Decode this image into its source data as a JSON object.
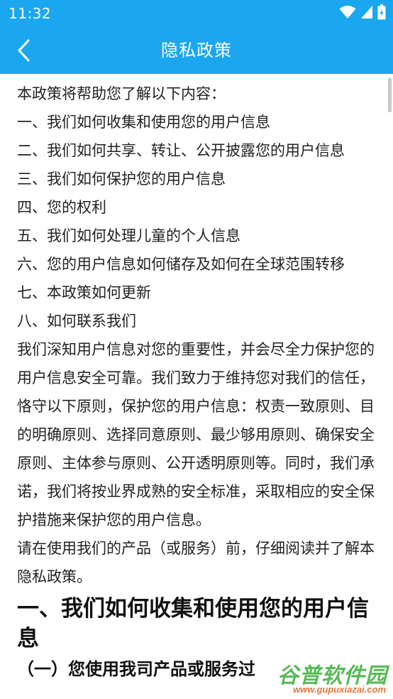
{
  "status_bar": {
    "time": "11:32",
    "icons": [
      "wifi-icon",
      "signal-icon",
      "battery-icon"
    ]
  },
  "app_bar": {
    "title": "隐私政策",
    "back_icon": "chevron-left-icon"
  },
  "colors": {
    "primary": "#1aa7f0",
    "text": "#222222",
    "on_primary": "#ffffff"
  },
  "content": {
    "intro": "本政策将帮助您了解以下内容：",
    "toc": [
      "一、我们如何收集和使用您的用户信息",
      "二、我们如何共享、转让、公开披露您的用户信息",
      "三、我们如何保护您的用户信息",
      "四、您的权利",
      "五、我们如何处理儿童的个人信息",
      "六、您的用户信息如何储存及如何在全球范围转移",
      "七、本政策如何更新",
      "八、如何联系我们"
    ],
    "para1": "我们深知用户信息对您的重要性，并会尽全力保护您的用户信息安全可靠。我们致力于维持您对我们的信任，恪守以下原则，保护您的用户信息：权责一致原则、目的明确原则、选择同意原则、最少够用原则、确保安全原则、主体参与原则、公开透明原则等。同时，我们承诺，我们将按业界成熟的安全标准，采取相应的安全保护措施来保护您的用户信息。",
    "para2": "请在使用我们的产品（或服务）前，仔细阅读并了解本隐私政策。",
    "heading1": "一、我们如何收集和使用您的用户信息",
    "heading2": "（一）您使用我司产品或服务过"
  },
  "watermark": {
    "name": "谷普软件园",
    "url": "www.gupuxiazai.com"
  }
}
